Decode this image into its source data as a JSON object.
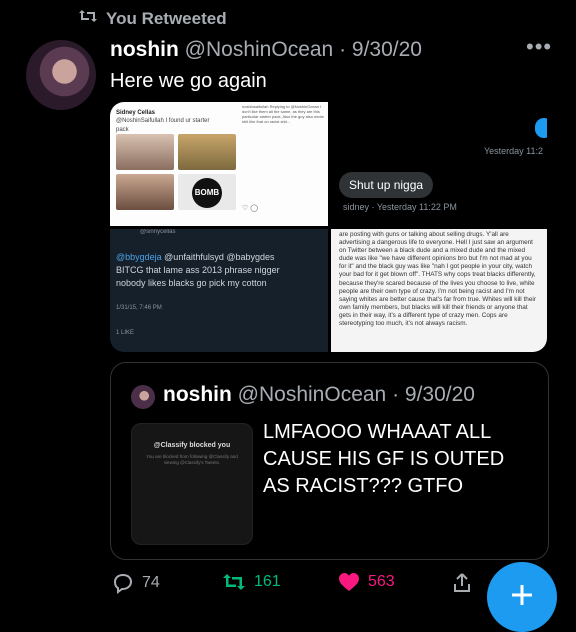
{
  "retweet_label": "You Retweeted",
  "tweet": {
    "display_name": "noshin",
    "handle_date": "@NoshinOcean · 9/30/20",
    "text": "Here we go again"
  },
  "media": {
    "image1": {
      "name": "Sidney Cellas",
      "line1": "@NoshinSaifullah I found ur starter",
      "line2": "pack",
      "bomb": "BOMB",
      "right_text": "noshinsaifullah Replying to @NoshinOcean I don't like them all the same, as they are this particular starter pack, Also the guy also wrote shit like that on racist shit..."
    },
    "image2": {
      "timestamp1": "Yesterday 11:2",
      "message": "Shut up nigga",
      "timestamp2": "sidney · Yesterday 11:22 PM"
    },
    "image3": {
      "top_cut": "@sinnycellas",
      "line1_link": "@bbygdeja",
      "line1_rest": " @unfaithfulsyd @babygdes",
      "line2": "BITCG that lame ass 2013 phrase nigger",
      "line3": "nobody likes blacks go pick my cotton",
      "timestamp": "1/31/15, 7:46 PM",
      "likes": "1 LIKE"
    },
    "image4": {
      "text": "are posting with guns or talking about selling drugs. Y'all are advertising a dangerous life to everyone. Hell I just saw an argument on Twitter between a black dude and a mixed dude and the mixed dude was like \"we have different opinions bro but I'm not mad at you for it\" and the black guy was like \"nah I got people in your city, watch your bad for it get blown off\". THATS why cops treat blacks differently, because they're scared because of the lives you choose to live, white people are their own type of crazy. I'm not being racist and I'm not saying whites are better cause that's far from true. Whites will kill their own family members, but blacks will kill their friends or anyone that gets in their way, it's a different type of crazy men. Cops are stereotyping too much, it's not always racism."
    }
  },
  "quote": {
    "display_name": "noshin",
    "handle_date": "@NoshinOcean · 9/30/20",
    "text": "LMFAOOO WHAAAT ALL CAUSE HIS GF IS OUTED AS RACIST??? GTFO",
    "thumb_title": "@Classify blocked you",
    "thumb_sub": "You are blocked from following @Classify and viewing @Classify's Tweets."
  },
  "actions": {
    "replies": "74",
    "retweets": "161",
    "likes": "563"
  },
  "colors": {
    "accent": "#1d9bf0",
    "retweet_green": "#00ba7c",
    "like_pink": "#f91880"
  }
}
